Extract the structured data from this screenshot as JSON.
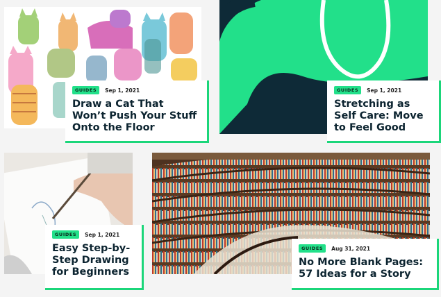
{
  "colors": {
    "accent": "#1bd67a",
    "badge": "#22e08a",
    "title": "#0c2430"
  },
  "articles": [
    {
      "category": "GUIDES",
      "date": "Sep 1, 2021",
      "title": "Draw a Cat That Won’t Push Your Stuff Onto the Floor",
      "image": "watercolor-cats-image"
    },
    {
      "category": "GUIDES",
      "date": "Sep 1, 2021",
      "title": "Stretching as Self Care: Move to Feel Good",
      "image": "green-abstract-image"
    },
    {
      "category": "GUIDES",
      "date": "Sep 1, 2021",
      "title": "Easy Step-by-Step Drawing for Beginners",
      "image": "hand-sketching-image"
    },
    {
      "category": "GUIDES",
      "date": "Aug 31, 2021",
      "title": "No More Blank Pages: 57 Ideas for a Story",
      "image": "library-bookshelves-image"
    }
  ]
}
